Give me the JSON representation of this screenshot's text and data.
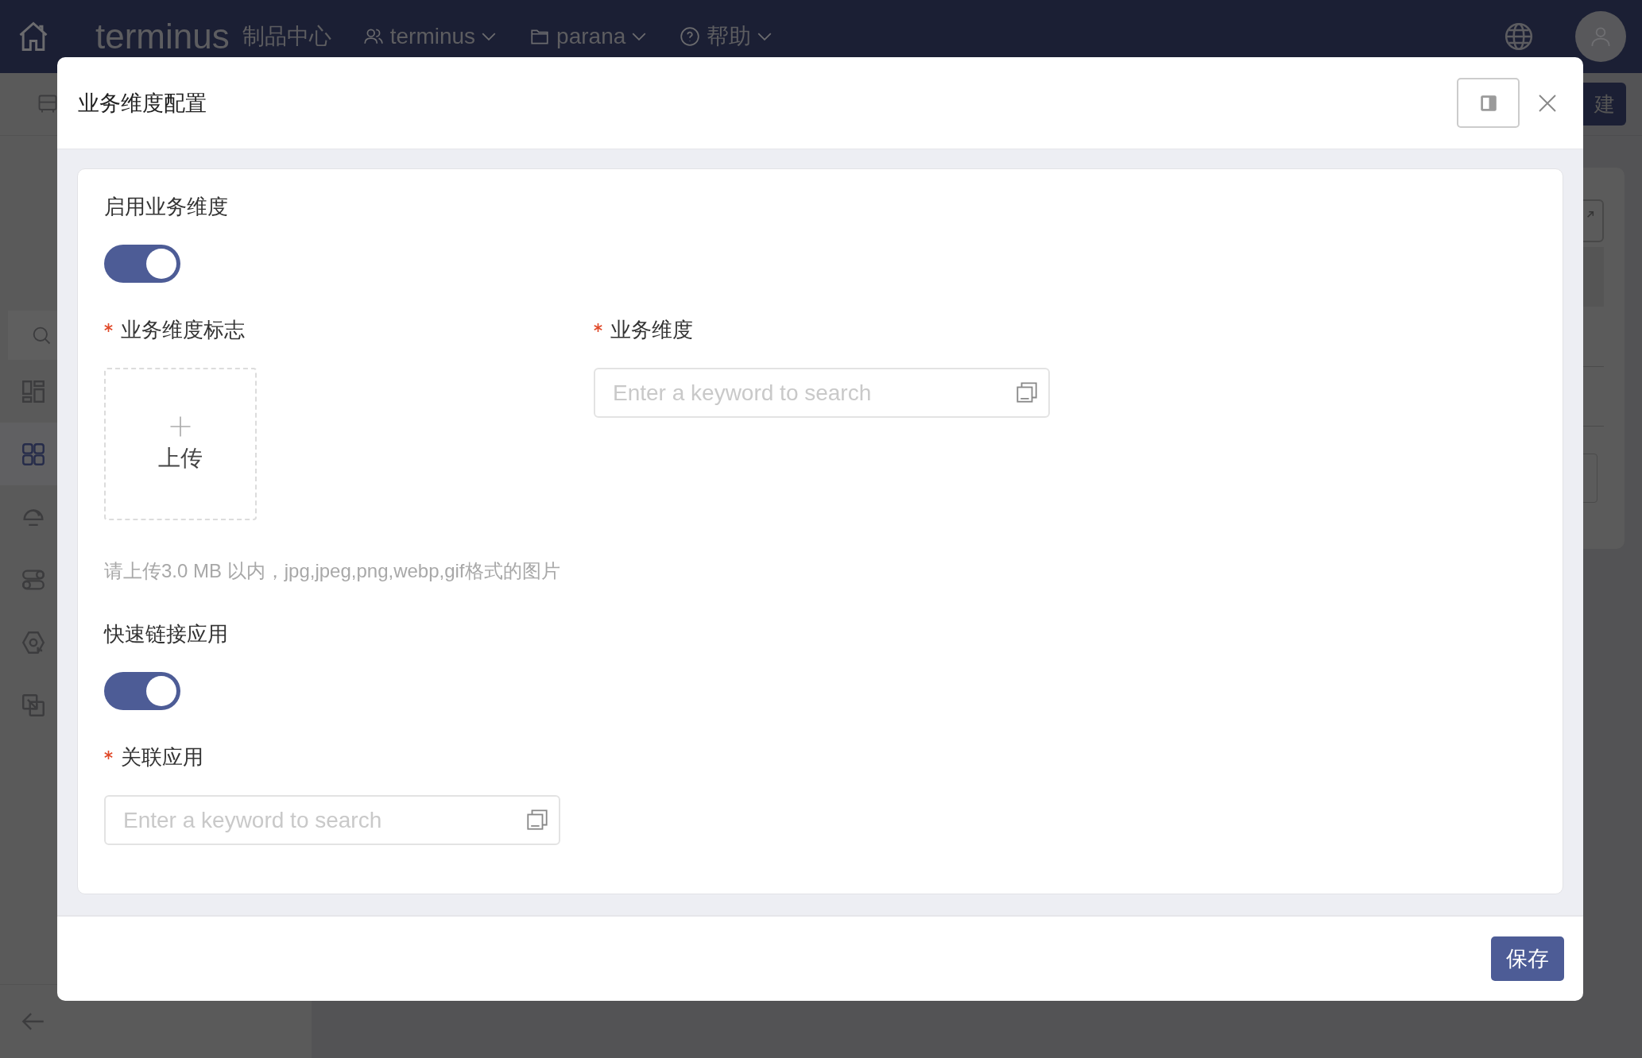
{
  "topbar": {
    "logo": "terminus",
    "product": "制品中心",
    "menus": [
      {
        "label": "terminus"
      },
      {
        "label": "parana"
      },
      {
        "label": "帮助"
      }
    ]
  },
  "page": {
    "create_button": "建"
  },
  "sidebar": {
    "items": [
      {
        "selected": false
      },
      {
        "selected": true
      },
      {
        "selected": false
      },
      {
        "selected": false
      },
      {
        "selected": false
      },
      {
        "selected": false
      }
    ]
  },
  "dialog": {
    "title": "业务维度配置",
    "rows": [
      [
        {
          "kind": "switch",
          "label": "启用业务维度",
          "required": false,
          "on": true
        }
      ],
      [
        {
          "kind": "upload",
          "label": "业务维度标志",
          "required": true,
          "button": "上传",
          "hint": "请上传3.0 MB 以内，jpg,jpeg,png,webp,gif格式的图片"
        },
        {
          "kind": "select",
          "label": "业务维度",
          "required": true,
          "placeholder": "Enter a keyword to search"
        }
      ],
      [
        {
          "kind": "switch",
          "label": "快速链接应用",
          "required": false,
          "on": true
        }
      ],
      [
        {
          "kind": "select",
          "label": "关联应用",
          "required": true,
          "placeholder": "Enter a keyword to search"
        }
      ]
    ],
    "save_button": "保存"
  }
}
